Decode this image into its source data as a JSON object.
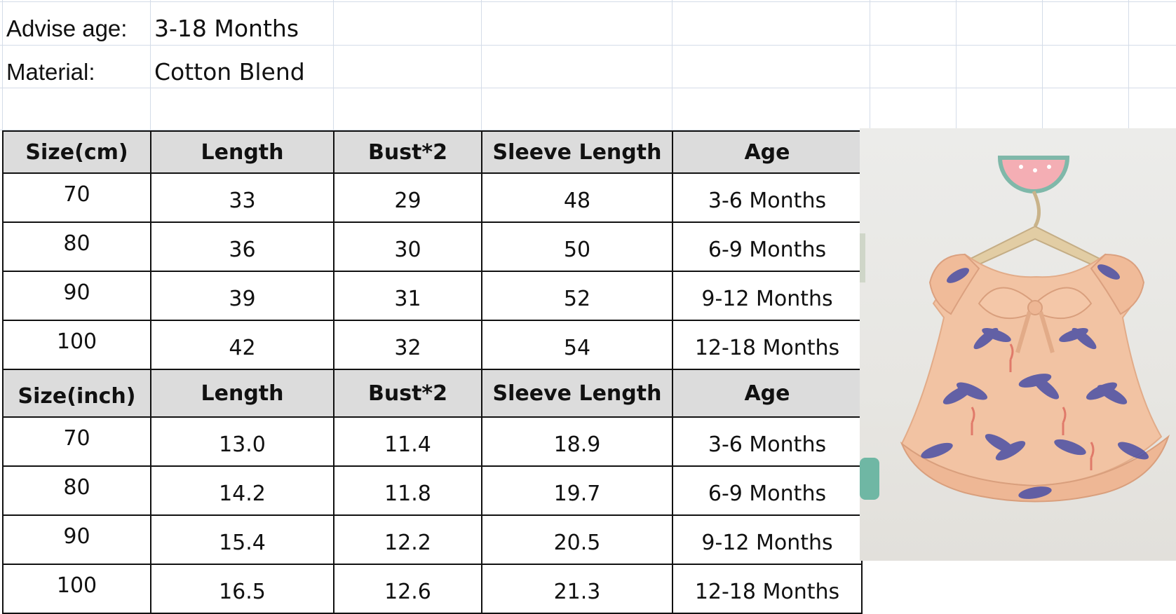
{
  "info": {
    "advise_age_label": "Advise age:",
    "advise_age_value": "3-18 Months",
    "material_label": "Material:",
    "material_value": "Cotton Blend"
  },
  "cm_table": {
    "headers": [
      "Size(cm)",
      "Length",
      "Bust*2",
      "Sleeve Length",
      "Age"
    ],
    "rows": [
      [
        "70",
        "33",
        "29",
        "48",
        "3-6 Months"
      ],
      [
        "80",
        "36",
        "30",
        "50",
        "6-9 Months"
      ],
      [
        "90",
        "39",
        "31",
        "52",
        "9-12 Months"
      ],
      [
        "100",
        "42",
        "32",
        "54",
        "12-18 Months"
      ]
    ]
  },
  "inch_table": {
    "headers": [
      "Size(inch)",
      "Length",
      "Bust*2",
      "Sleeve Length",
      "Age"
    ],
    "rows": [
      [
        "70",
        "13.0",
        "11.4",
        "18.9",
        "3-6 Months"
      ],
      [
        "80",
        "14.2",
        "11.8",
        "19.7",
        "6-9 Months"
      ],
      [
        "90",
        "15.4",
        "12.2",
        "20.5",
        "9-12 Months"
      ],
      [
        "100",
        "16.5",
        "12.6",
        "21.3",
        "12-18 Months"
      ]
    ]
  },
  "colors": {
    "header_fill": "#dcdcdc",
    "grid": "#d4dce8",
    "dress": "#f2c3a3",
    "palm_print": "#4a4fa6"
  },
  "photo": {
    "subject": "toddler dress on hanger with watermelon hook"
  }
}
